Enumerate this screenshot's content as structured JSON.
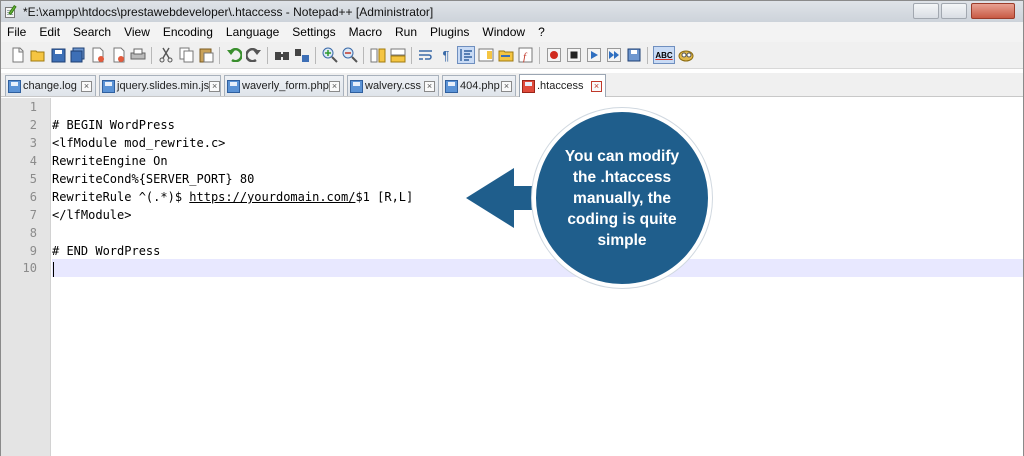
{
  "window": {
    "title": "*E:\\xampp\\htdocs\\prestawebdeveloper\\.htaccess - Notepad++ [Administrator]"
  },
  "menu": [
    "File",
    "Edit",
    "Search",
    "View",
    "Encoding",
    "Language",
    "Settings",
    "Macro",
    "Run",
    "Plugins",
    "Window",
    "?"
  ],
  "toolbar": {
    "icons": [
      "new-file-icon",
      "open-file-icon",
      "save-icon",
      "save-all-icon",
      "close-icon",
      "close-all-icon",
      "print-icon",
      "cut-icon",
      "copy-icon",
      "paste-icon",
      "undo-icon",
      "redo-icon",
      "find-icon",
      "replace-icon",
      "zoom-in-icon",
      "zoom-out-icon",
      "sync-vertical-icon",
      "sync-horizontal-icon",
      "word-wrap-icon",
      "show-all-characters-icon",
      "indent-guide-icon",
      "document-map-icon",
      "folder-icon",
      "function-list-icon",
      "record-macro-icon",
      "stop-recording-icon",
      "play-macro-icon",
      "run-macro-multiple-icon",
      "save-macro-icon",
      "spell-check-icon",
      "plugin-icon"
    ],
    "spellcheck_label": "ABC"
  },
  "tabs": [
    {
      "label": "change.log",
      "active": false
    },
    {
      "label": "jquery.slides.min.js",
      "active": false
    },
    {
      "label": "waverly_form.php",
      "active": false
    },
    {
      "label": "walvery.css",
      "active": false
    },
    {
      "label": "404.php",
      "active": false
    },
    {
      "label": ".htaccess",
      "active": true
    }
  ],
  "tab_close_glyph": "×",
  "editor": {
    "lines": [
      {
        "num": "1",
        "text": ""
      },
      {
        "num": "2",
        "text": "# BEGIN WordPress"
      },
      {
        "num": "3",
        "text": "<lfModule mod_rewrite.c>"
      },
      {
        "num": "4",
        "text": "RewriteEngine On"
      },
      {
        "num": "5",
        "text": "RewriteCond%{SERVER_PORT} 80"
      },
      {
        "num": "6",
        "text_before": "RewriteRule ^(.*)$ ",
        "url": "https://yourdomain.com/",
        "text_after": "$1 [R,L]"
      },
      {
        "num": "7",
        "text": "</lfModule>"
      },
      {
        "num": "8",
        "text": ""
      },
      {
        "num": "9",
        "text": "# END WordPress"
      },
      {
        "num": "10",
        "text": ""
      }
    ],
    "current_line": 10
  },
  "callout": {
    "lines": [
      "You can modify",
      "the .htaccess",
      "manually, the",
      "coding is quite",
      "simple"
    ]
  },
  "colors": {
    "callout": "#1f5e8c",
    "current_line": "#e8e8ff",
    "gutter": "#e4e4e4"
  }
}
